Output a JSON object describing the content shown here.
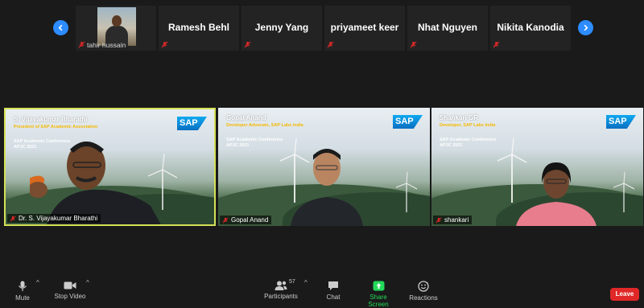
{
  "participants_strip": [
    {
      "name": "tahir hussain",
      "has_video": true,
      "muted": true
    },
    {
      "name": "Ramesh Behl",
      "has_video": false,
      "muted": true
    },
    {
      "name": "Jenny Yang",
      "has_video": false,
      "muted": true
    },
    {
      "name": "priyameet keer",
      "has_video": false,
      "muted": true
    },
    {
      "name": "Nhat Nguyen",
      "has_video": false,
      "muted": true
    },
    {
      "name": "Nikita Kanodia",
      "has_video": false,
      "muted": true
    }
  ],
  "tiles": [
    {
      "overlay_name": "S. Vijayakumar Bharathi",
      "overlay_role": "President of SAP Academic Association",
      "conference_line1": "SAP Academic Conference",
      "conference_line2": "APJC 2021",
      "logo": "SAP",
      "label": "Dr. S. Vijayakumar Bharathi",
      "active_speaker": true
    },
    {
      "overlay_name": "Gopal Anand",
      "overlay_role": "Developer Advocate, SAP Labs India",
      "conference_line1": "SAP Academic Conference",
      "conference_line2": "APJC 2021",
      "logo": "SAP",
      "label": "Gopal Anand",
      "active_speaker": false
    },
    {
      "overlay_name": "Shankari GR",
      "overlay_role": "Developer, SAP Labs India",
      "conference_line1": "SAP Academic Conference",
      "conference_line2": "APJC 2021",
      "logo": "SAP",
      "label": "shankari",
      "active_speaker": false
    }
  ],
  "toolbar": {
    "mute_label": "Mute",
    "stop_video_label": "Stop Video",
    "participants_label": "Participants",
    "participants_count": "57",
    "chat_label": "Chat",
    "share_screen_label": "Share Screen",
    "reactions_label": "Reactions",
    "leave_label": "Leave"
  },
  "colors": {
    "accent_blue": "#2d8cff",
    "share_green": "#23d959",
    "leave_red": "#e02828",
    "active_border": "#d4e157",
    "role_yellow": "#f5b800"
  }
}
